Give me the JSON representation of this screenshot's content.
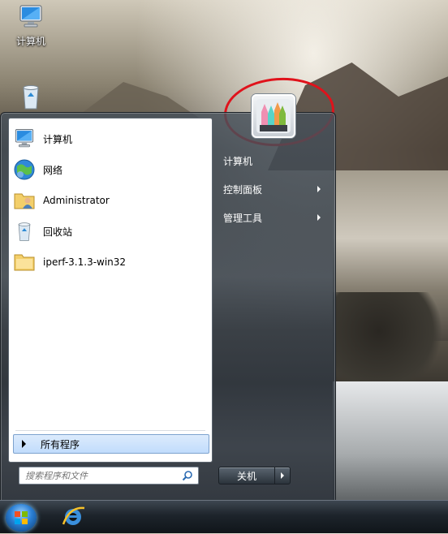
{
  "desktop": {
    "icons": [
      {
        "label": "计算机",
        "icon": "computer-icon"
      },
      {
        "label": "",
        "icon": "recycle-bin-icon"
      }
    ]
  },
  "start_menu": {
    "pinned": [
      {
        "label": "计算机",
        "icon": "computer-icon"
      },
      {
        "label": "网络",
        "icon": "network-icon"
      },
      {
        "label": "Administrator",
        "icon": "user-folder-icon"
      },
      {
        "label": "回收站",
        "icon": "recycle-bin-icon"
      },
      {
        "label": "iperf-3.1.3-win32",
        "icon": "folder-icon"
      }
    ],
    "all_programs_label": "所有程序",
    "search": {
      "placeholder": "搜索程序和文件",
      "value": ""
    },
    "right": {
      "items": [
        {
          "label": "计算机",
          "has_submenu": false
        },
        {
          "label": "控制面板",
          "has_submenu": true
        },
        {
          "label": "管理工具",
          "has_submenu": true
        }
      ]
    },
    "shutdown_label": "关机",
    "accent_color": "#c1dcfc",
    "annotation_color": "#e0121b"
  },
  "taskbar": {
    "items": [
      {
        "icon": "start-orb-icon"
      },
      {
        "icon": "internet-explorer-icon"
      }
    ]
  }
}
